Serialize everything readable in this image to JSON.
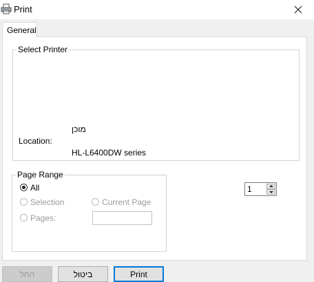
{
  "window": {
    "title": "Print"
  },
  "tabs": [
    {
      "label": "General"
    }
  ],
  "select_printer": {
    "legend": "Select Printer",
    "status_value": "מוכן",
    "location_label": "Location:",
    "printer_name": "HL-L6400DW series"
  },
  "page_range": {
    "legend": "Page Range",
    "all_label": "All",
    "selection_label": "Selection",
    "current_page_label": "Current Page",
    "pages_label": "Pages:",
    "pages_value": "",
    "selected": "All"
  },
  "copies": {
    "value": "1"
  },
  "buttons": {
    "apply_label": "החל",
    "cancel_label": "ביטול",
    "print_label": "Print"
  }
}
